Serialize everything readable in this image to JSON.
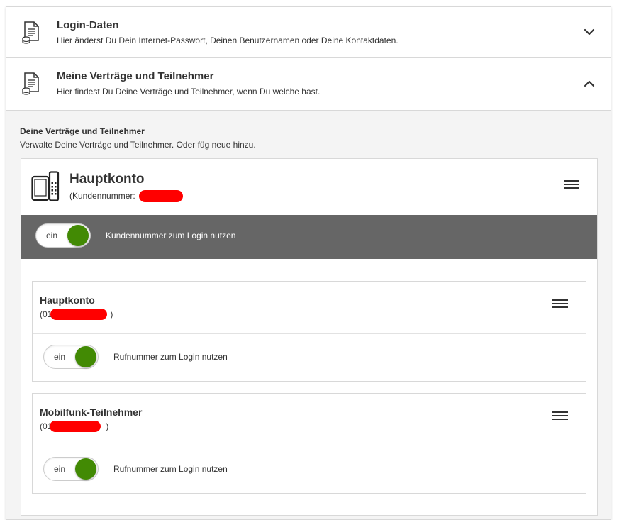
{
  "accordion": [
    {
      "title": "Login-Daten",
      "subtitle": "Hier änderst Du Dein Internet-Passwort, Deinen Benutzernamen oder Deine Kontaktdaten.",
      "icon": "document-icon",
      "expanded": false
    },
    {
      "title": "Meine Verträge und Teilnehmer",
      "subtitle": "Hier findest Du Deine Verträge und Teilnehmer, wenn Du welche hast.",
      "icon": "document-icon",
      "expanded": true
    }
  ],
  "section": {
    "title": "Deine Verträge und Teilnehmer",
    "subtitle": "Verwalte Deine Verträge und Teilnehmer. Oder füg neue hinzu."
  },
  "account": {
    "title": "Hauptkonto",
    "customer_prefix": "(Kundennummer:",
    "customer_suffix": ")",
    "toggle_text": "ein",
    "toggle_label": "Kundennummer zum Login nutzen"
  },
  "subscribers": [
    {
      "title": "Hauptkonto",
      "number_prefix": "(01",
      "number_suffix": ")",
      "toggle_text": "ein",
      "toggle_label": "Rufnummer zum Login nutzen"
    },
    {
      "title": "Mobilfunk-Teilnehmer",
      "number_prefix": "(01",
      "number_suffix": ")",
      "toggle_text": "ein",
      "toggle_label": "Rufnummer zum Login nutzen"
    }
  ],
  "colors": {
    "toggle_on": "#428a04",
    "gray_bar": "#666666",
    "redaction": "#ff0000"
  }
}
